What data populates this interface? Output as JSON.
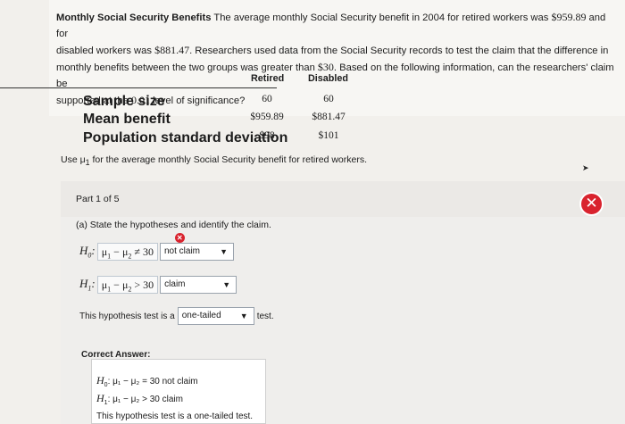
{
  "problem": {
    "title": "Monthly Social Security Benefits",
    "text_before_retired": "The average monthly Social Security benefit in 2004 for retired workers was",
    "retired_2004": "$959.89",
    "text_and_for": "and for",
    "text_disabled": "disabled workers was",
    "disabled_2004": "$881.47",
    "text_researchers": ". Researchers used data from the Social Security records to test the claim that the difference in",
    "text_line3": "monthly benefits between the two groups was greater than",
    "diff_value": "$30",
    "text_line3b": ". Based on the following information, can the researchers' claim be",
    "text_line4": "supported at the",
    "alpha": "0.01",
    "text_line4b": "level of significance?"
  },
  "table": {
    "col_retired": "Retired",
    "col_disabled": "Disabled",
    "rows": [
      {
        "label": "Sample size",
        "retired": "60",
        "disabled": "60"
      },
      {
        "label": "Mean benefit",
        "retired": "$959.89",
        "disabled": "$881.47"
      },
      {
        "label": "Population standard deviation",
        "retired": "$98",
        "disabled": "$101"
      }
    ]
  },
  "use_note": {
    "prefix": "Use",
    "symbol": "μ",
    "sub": "1",
    "suffix": "for the average monthly Social Security benefit for retired workers."
  },
  "part": {
    "label": "Part 1 of 5",
    "question": "(a) State the hypotheses and identify the claim.",
    "h0": {
      "label": "H",
      "sub": "0",
      "expr_mu1": "μ",
      "expr_mu2": "μ",
      "operator": "≠",
      "value": "30",
      "claim_select": "not claim"
    },
    "h1": {
      "label": "H",
      "sub": "1",
      "expr_mu1": "μ",
      "expr_mu2": "μ",
      "operator": ">",
      "value": "30",
      "claim_select": "claim"
    },
    "test_prefix": "This hypothesis test is a",
    "test_select": "one-tailed",
    "test_suffix": "test.",
    "status_icon": "✕",
    "error_icon": "✕"
  },
  "correct_answer": {
    "title": "Correct Answer:",
    "line1_expr": "μ₁ − μ₂ = 30",
    "line1_claim": "not claim",
    "line2_expr": "μ₁ − μ₂ > 30",
    "line2_claim": "claim",
    "line3": "This hypothesis test is a one-tailed test."
  },
  "colors": {
    "error": "#d9232e",
    "background": "#f2f0ec"
  }
}
